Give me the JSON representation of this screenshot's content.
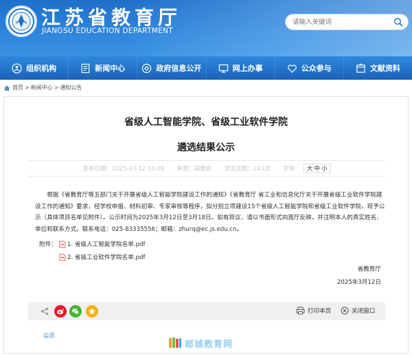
{
  "header": {
    "title_cn": "江苏省教育厅",
    "title_en": "JIANGSU EDUCATION DEPARTMENT",
    "search_placeholder": "请输入关键词"
  },
  "nav": {
    "items": [
      {
        "label": "组织机构",
        "icon": "org-icon"
      },
      {
        "label": "新闻中心",
        "icon": "news-icon"
      },
      {
        "label": "政府信息公开",
        "icon": "info-icon"
      },
      {
        "label": "网上办事",
        "icon": "online-service-icon"
      },
      {
        "label": "公众参与",
        "icon": "heart-icon"
      },
      {
        "label": "文献资料",
        "icon": "documents-icon"
      }
    ]
  },
  "breadcrumb": [
    "首页",
    "新闻中心",
    "通知公告"
  ],
  "breadcrumb_sep": ">",
  "article": {
    "title_line1": "省级人工智能学院、省级工业软件学院",
    "title_line2": "遴选结果公示",
    "publish_label": "发布日期：",
    "publish_date": "2025-03-12 16:09",
    "source_label": "来源：",
    "source": "高教处",
    "views_label": "浏览次数：",
    "views": "243次",
    "fontsize_label": "字体：",
    "fontsize_options": [
      "大",
      "中",
      "小"
    ],
    "body": "根据《省教育厅等五部门关于开展省级人工智能学院建设工作的通知》《省教育厅 省工业和信息化厅关于开展省级工业软件学院建设工作的通知》要求，经学校申报、材料初审、专家审核等程序，拟分别立项建设15个省级人工智能学院和省级工业软件学院，现予公示（具体项目名单见附件）。公示时间为2025年3月12日至3月18日。如有异议，请以书面形式向我厅反映，并注明本人的真实姓名、单位和联系方式。联系电话：025-83335556；邮箱：zhurq@ec.js.edu.cn。",
    "attachments_label": "附件：",
    "attachments": [
      "1. 省级人工智能学院名单.pdf",
      "2. 省级工业软件学院名单.pdf"
    ],
    "signature": "省教育厅",
    "sign_date": "2025年3月12日"
  },
  "actions": {
    "print_label": "打印本页",
    "close_label": "关闭窗口"
  },
  "footer_link": "公示",
  "watermark": "邮城教育网",
  "colors": {
    "header_blue": "#1e6fc9",
    "nav_blue": "#1a63bb",
    "link_blue": "#1a6fc4",
    "weibo_red": "#e6162d",
    "wechat_green": "#42b72a",
    "fav_yellow": "#f5b016"
  }
}
